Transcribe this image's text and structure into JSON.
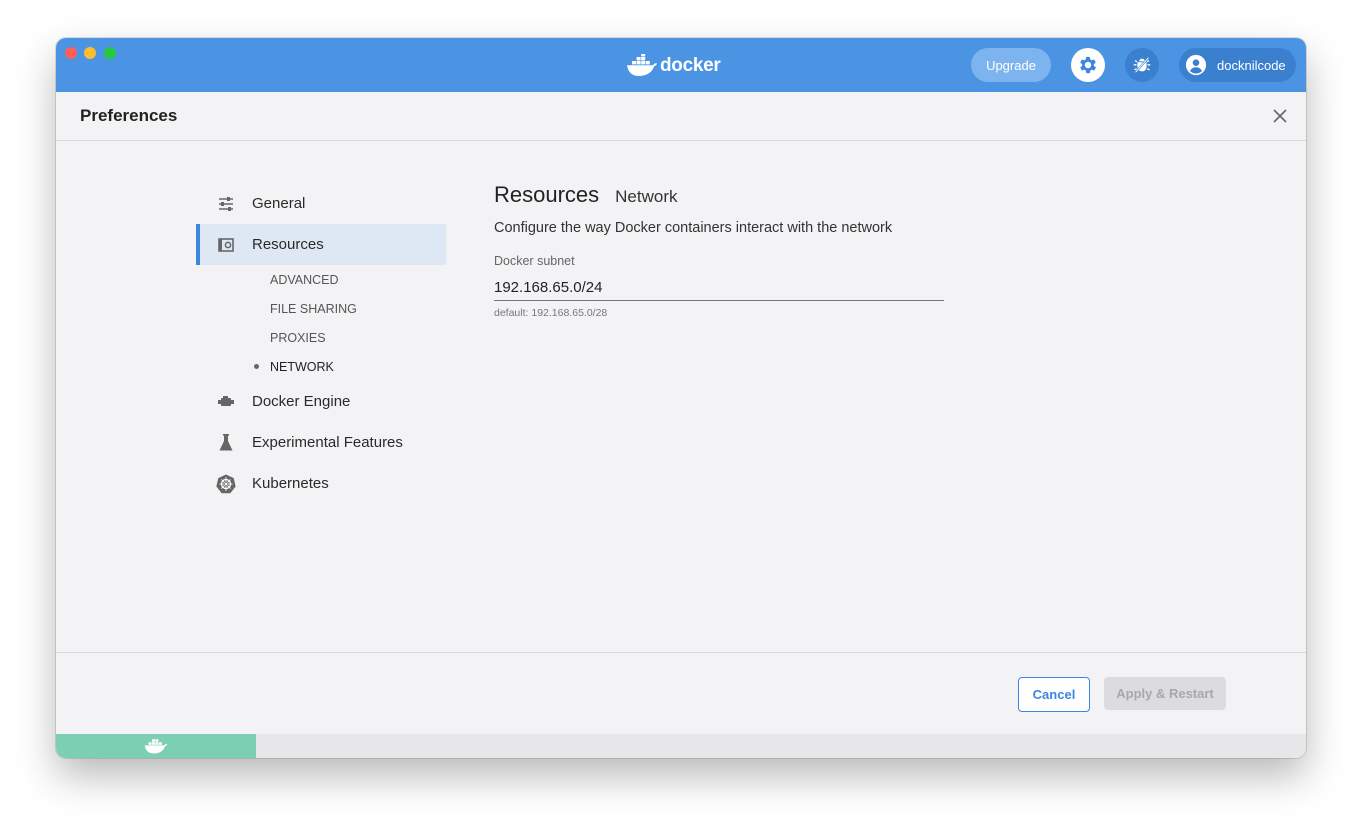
{
  "titlebar": {
    "logo_text": "docker",
    "upgrade_label": "Upgrade",
    "username": "docknilcode",
    "accent_color": "#4a94e3"
  },
  "preferences": {
    "title": "Preferences"
  },
  "sidebar": {
    "items": [
      {
        "label": "General",
        "icon": "sliders-icon"
      },
      {
        "label": "Resources",
        "icon": "resources-icon",
        "active": true
      },
      {
        "label": "Docker Engine",
        "icon": "engine-icon"
      },
      {
        "label": "Experimental Features",
        "icon": "flask-icon"
      },
      {
        "label": "Kubernetes",
        "icon": "kubernetes-icon"
      }
    ],
    "resources_subitems": [
      {
        "label": "ADVANCED"
      },
      {
        "label": "FILE SHARING"
      },
      {
        "label": "PROXIES"
      },
      {
        "label": "NETWORK",
        "active": true
      }
    ]
  },
  "content": {
    "section": "Resources",
    "subsection": "Network",
    "description": "Configure the way Docker containers interact with the network",
    "subnet_label": "Docker subnet",
    "subnet_value": "192.168.65.0/24",
    "subnet_hint": "default: 192.168.65.0/28"
  },
  "footer": {
    "cancel_label": "Cancel",
    "apply_label": "Apply & Restart"
  },
  "status": {
    "engine_color": "#7dcfb3"
  }
}
